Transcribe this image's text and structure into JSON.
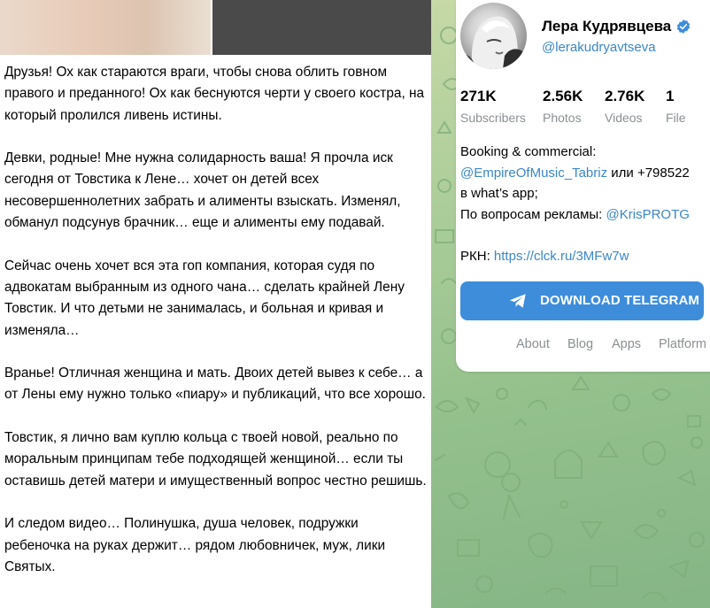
{
  "post": {
    "paragraphs": [
      "Друзья! Ох как стараются враги, чтобы снова облить говном правого и преданного! Ох как беснуются черти у своего костра, на который пролился ливень истины.",
      "Девки, родные! Мне нужна солидарность ваша! Я прочла иск сегодня от Товстика к Лене… хочет он детей всех несовершеннолетних забрать и алименты взыскать. Изменял, обманул подсунув брачник… еще и алименты ему подавай.",
      "Сейчас очень хочет вся эта гоп компания, которая судя по адвокатам выбранным из одного чана… сделать крайней Лену Товстик. И что детьми не занималась, и больная и кривая и изменяла…",
      "Вранье! Отличная женщина и мать. Двоих детей вывез к себе… а от Лены ему нужно только «пиару» и публикаций, что все хорошо.",
      "Товстик, я лично вам куплю кольца с твоей новой, реально по моральным принципам тебе подходящей женщиной… если ты оставишь детей матери и имущественный вопрос честно решишь.",
      "И следом видео… Полинушка, душа человек, подружки ребеночка на руках держит… рядом любовничек, муж, лики Святых."
    ]
  },
  "channel": {
    "name": "Лера Кудрявцева",
    "handle": "@lerakudryavtseva",
    "verified_icon": "verified-check-icon",
    "stats": [
      {
        "value": "271K",
        "label": "Subscribers"
      },
      {
        "value": "2.56K",
        "label": "Photos"
      },
      {
        "value": "2.76K",
        "label": "Videos"
      },
      {
        "value": "1",
        "label": "File"
      }
    ],
    "bio": {
      "line1": "Booking & commercial:",
      "line2_link": "@EmpireOfMusic_Tabriz",
      "line2_text": " или +798522",
      "line3": "в what’s app;",
      "line4_text": "По вопросам рекламы: ",
      "line4_link": "@KrisPROTG",
      "line5_text": "РКН: ",
      "line5_link": "https://clck.ru/3MFw7w"
    }
  },
  "download_button": {
    "label": "DOWNLOAD TELEGRAM",
    "icon": "telegram-plane-icon"
  },
  "footer": {
    "links": [
      "About",
      "Blog",
      "Apps",
      "Platform"
    ]
  },
  "colors": {
    "accent": "#3d8ddb",
    "link": "#3b86c7",
    "muted": "#8b8f93",
    "background_green": "#a9cc98"
  }
}
